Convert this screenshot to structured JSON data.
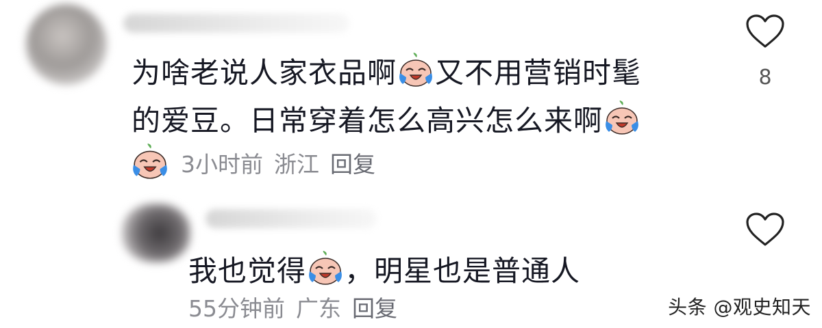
{
  "comments": [
    {
      "text_parts": [
        "为啥老说人家衣品啊",
        "又不用营销时髦",
        "的爱豆。日常穿着怎么高兴怎么来啊"
      ],
      "meta": {
        "time": "3小时前",
        "location": "浙江",
        "reply": "回复"
      },
      "likes": "8"
    },
    {
      "text_parts": [
        "我也觉得",
        "，明星也是普通人"
      ],
      "meta": {
        "time": "55分钟前",
        "location": "广东",
        "reply": "回复"
      },
      "likes": ""
    }
  ],
  "icons": {
    "like": "heart-outline-icon",
    "emoji": "crying-face-emoji"
  },
  "colors": {
    "text": "#161823",
    "meta": "#8a8b91",
    "tear": "#3a8ee6",
    "emoji_face": "#f6c3b3"
  },
  "watermark": "头条 @观史知天"
}
